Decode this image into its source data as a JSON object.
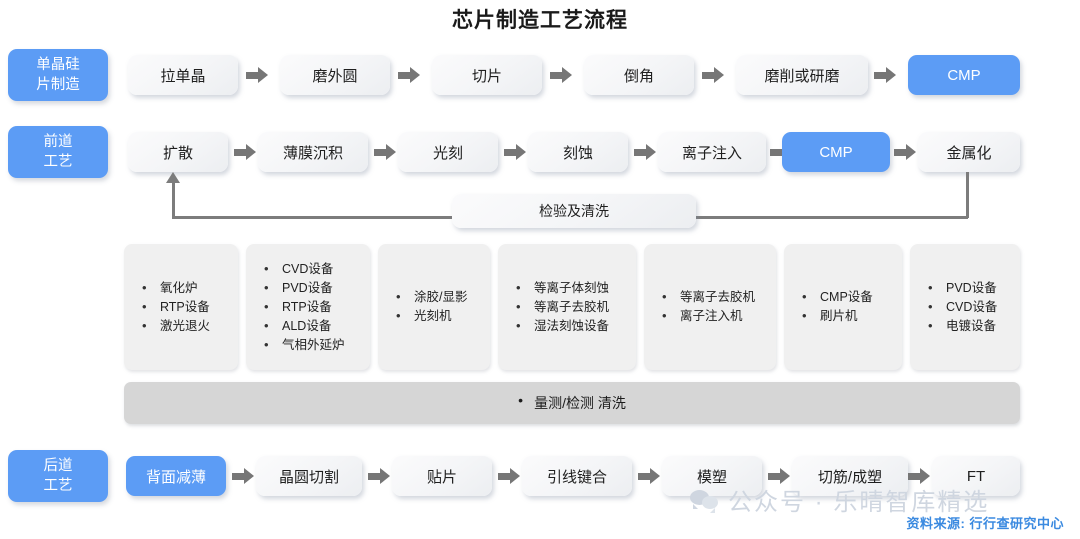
{
  "title": "芯片制造工艺流程",
  "colors": {
    "accent_blue": "#5c9cf5",
    "box_gray": "#f2f3f5",
    "bar_gray": "#d6d6d6",
    "arrow_gray": "#767676",
    "source_blue": "#3b8ae0",
    "watermark_gray": "#cfd6e0"
  },
  "stages": [
    {
      "id": "wafer",
      "line1": "单晶硅",
      "line2": "片制造"
    },
    {
      "id": "frontend",
      "line1": "前道",
      "line2": "工艺"
    },
    {
      "id": "backend",
      "line1": "后道",
      "line2": "工艺"
    }
  ],
  "rows": {
    "wafer_steps": [
      {
        "label": "拉单晶",
        "highlight": false
      },
      {
        "label": "磨外圆",
        "highlight": false
      },
      {
        "label": "切片",
        "highlight": false
      },
      {
        "label": "倒角",
        "highlight": false
      },
      {
        "label": "磨削或研磨",
        "highlight": false
      },
      {
        "label": "CMP",
        "highlight": true
      }
    ],
    "frontend_steps": [
      {
        "label": "扩散",
        "highlight": false
      },
      {
        "label": "薄膜沉积",
        "highlight": false
      },
      {
        "label": "光刻",
        "highlight": false
      },
      {
        "label": "刻蚀",
        "highlight": false
      },
      {
        "label": "离子注入",
        "highlight": false
      },
      {
        "label": "CMP",
        "highlight": true
      },
      {
        "label": "金属化",
        "highlight": false
      }
    ],
    "backend_steps": [
      {
        "label": "背面减薄",
        "highlight": true
      },
      {
        "label": "晶圆切割",
        "highlight": false
      },
      {
        "label": "贴片",
        "highlight": false
      },
      {
        "label": "引线键合",
        "highlight": false
      },
      {
        "label": "模塑",
        "highlight": false
      },
      {
        "label": "切筋/成塑",
        "highlight": false
      },
      {
        "label": "FT",
        "highlight": false
      }
    ]
  },
  "feedback_loop": {
    "label": "检验及清洗"
  },
  "equipment_columns": [
    {
      "id": "diffusion",
      "items": [
        "氧化炉",
        "RTP设备",
        "激光退火"
      ]
    },
    {
      "id": "deposition",
      "items": [
        "CVD设备",
        "PVD设备",
        "RTP设备",
        "ALD设备",
        "气相外延炉"
      ]
    },
    {
      "id": "litho",
      "items": [
        "涂胶/显影",
        "光刻机"
      ]
    },
    {
      "id": "etch",
      "items": [
        "等离子体刻蚀",
        "等离子去胶机",
        "湿法刻蚀设备"
      ]
    },
    {
      "id": "implant",
      "items": [
        "等离子去胶机",
        "离子注入机"
      ]
    },
    {
      "id": "cmp",
      "items": [
        "CMP设备",
        "刷片机"
      ]
    },
    {
      "id": "metal",
      "items": [
        "PVD设备",
        "CVD设备",
        "电镀设备"
      ]
    }
  ],
  "measurement_bar": {
    "label": "量测/检测  清洗"
  },
  "watermark": {
    "text": "公众号 · 乐晴智库精选"
  },
  "source": {
    "text": "资料来源: 行行查研究中心"
  }
}
